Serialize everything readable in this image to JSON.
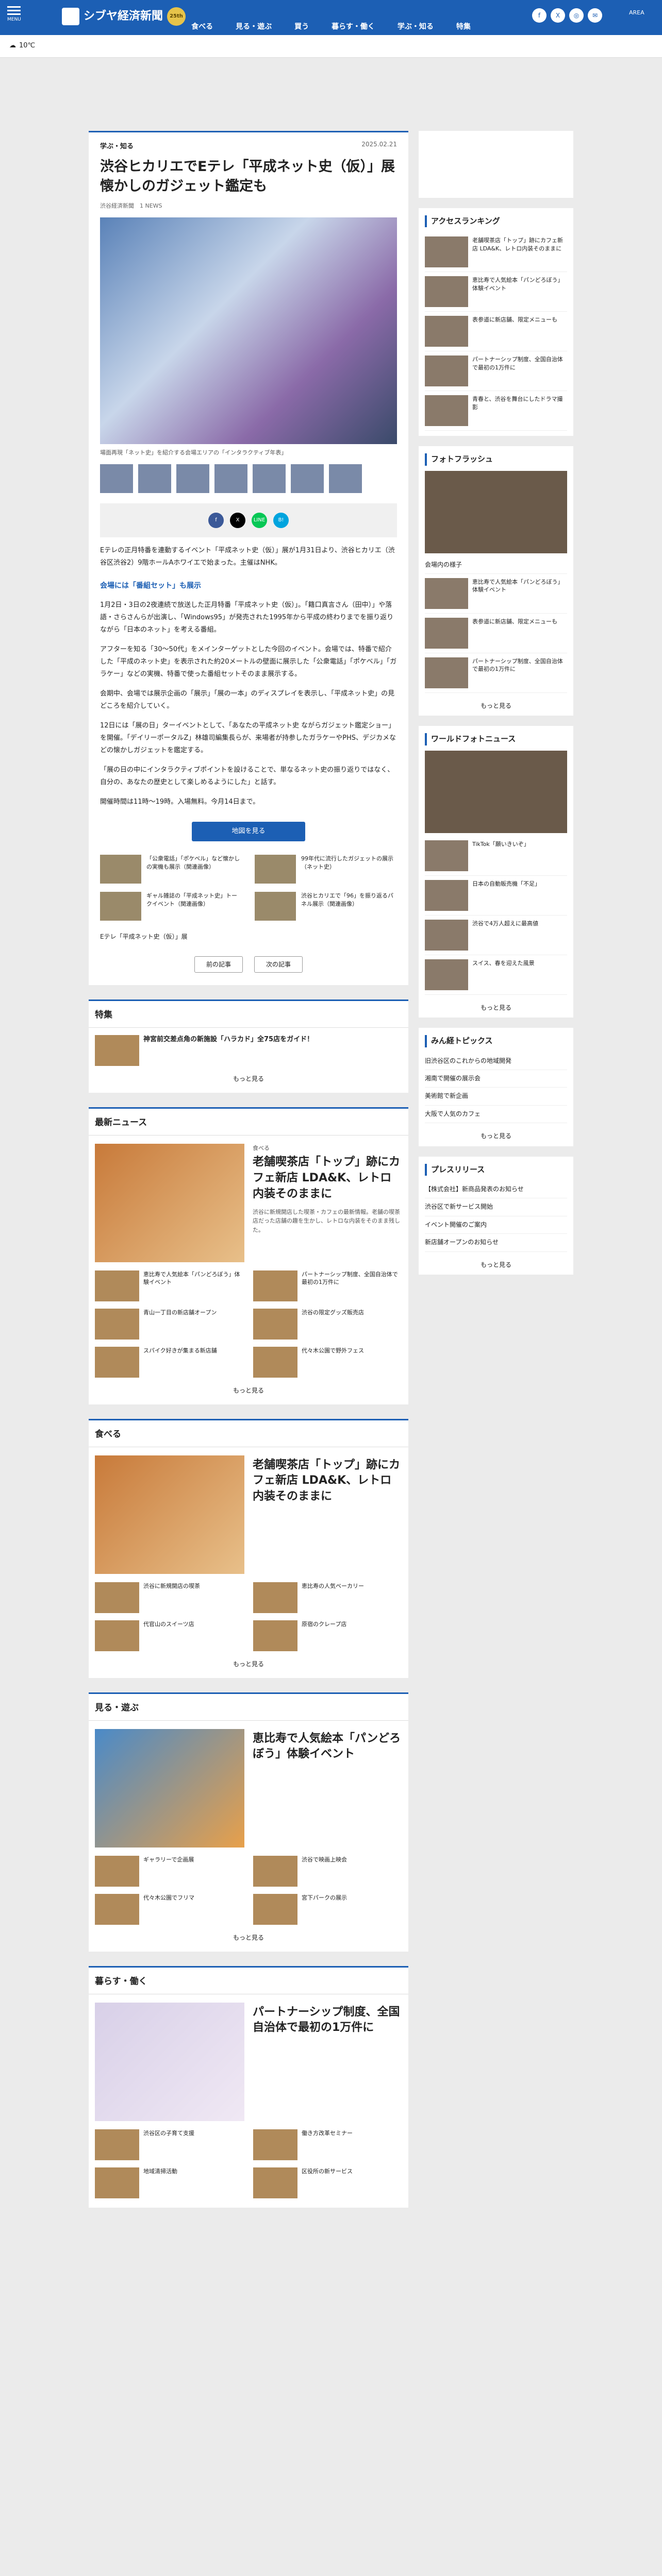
{
  "header": {
    "menu_label": "MENU",
    "site_name": "シブヤ経済新聞",
    "anniversary": "25th",
    "area_label": "AREA",
    "sns": [
      "f",
      "X",
      "◎",
      "✉"
    ]
  },
  "nav": [
    "食べる",
    "見る・遊ぶ",
    "買う",
    "暮らす・働く",
    "学ぶ・知る",
    "特集"
  ],
  "weather": {
    "temp": "10℃"
  },
  "article": {
    "category": "学ぶ・知る",
    "date": "2025.02.21",
    "title": "渋谷ヒカリエでEテレ「平成ネット史（仮）」展　懐かしのガジェット鑑定も",
    "meta": "渋谷経済新聞　1 NEWS",
    "caption": "場面再現「ネット史」を紹介する会場エリアの「インタラクティブ年表」",
    "share": [
      "f",
      "X",
      "LINE",
      "B!"
    ],
    "paragraphs": [
      "Eテレの正月特番を連動するイベント「平成ネット史（仮）」展が1月31日より、渋谷ヒカリエ（渋谷区渋谷2）9階ホールAホワイエで始まった。主催はNHK。",
      "1月2日・3日の2夜連続で放送した正月特番「平成ネット史（仮）」。「籍口真言さん（田中）」や落語・さらさんらが出演し、「Windows95」が発売された1995年から平成の終わりまでを振り返りながら「日本のネット」を考える番組。",
      "アフターを知る「30〜50代」をメインターゲットとした今回のイベント。会場では、特番で紹介した「平成のネット史」を表示された約20メートルの壁面に展示した「公衆電話」「ポケベル」「ガラケー」などの実機、特番で使った番組セットそのまま展示する。",
      "会期中、会場では展示企画の「展示」「展の一本」のディスプレイを表示し、「平成ネット史」の見どころを紹介していく。",
      "12日には「展の日」ターイベントとして、「あなたの平成ネット史 ながらガジェット鑑定ショー」を開催。「デイリーポータルZ」林雄司編集長らが、来場者が持参したガラケーやPHS、デジカメなどの懐かしガジェットを鑑定する。",
      "「展の日の中にインタラクティブポイントを設けることで、単なるネット史の振り返りではなく、自分の、あなたの歴史として楽しめるようにした」と話す。",
      "開催時間は11時〜19時。入場無料。今月14日まで。"
    ],
    "subhead": "会場には「番組セット」も展示",
    "map_button": "地図を見る",
    "related": [
      "「公衆電話」「ポケベル」など懐かしの実機も展示（関連画像）",
      "99年代に流行したガジェットの展示（ネット史）",
      "ギャル雑誌の「平成ネット史」トークイベント（関連画像）",
      "渋谷ヒカリエで「96」を振り返るパネル展示（関連画像）"
    ],
    "tags": [
      "Eテレ「平成ネット史（仮）」展"
    ],
    "pager": [
      "前の記事",
      "次の記事"
    ]
  },
  "feature": {
    "title": "特集",
    "item": "神宮前交差点角の新施設「ハラカド」全75店をガイド！"
  },
  "latest": {
    "title": "最新ニュース",
    "lead_cat": "食べる",
    "lead_title": "老舗喫茶店「トップ」跡にカフェ新店 LDA&K、レトロ内装そのままに",
    "lead_text": "渋谷に新規開店した喫茶・カフェの最新情報。老舗の喫茶店だった店舗の趣を生かし、レトロな内装をそのまま残した。",
    "items": [
      "恵比寿で人気絵本「パンどろぼう」体験イベント",
      "パートナーシップ制度、全国自治体で最初の1万件に",
      "青山一丁目の新店舗オープン",
      "渋谷の限定グッズ販売店",
      "スパイク好きが集まる新店舗",
      "代々木公園で野外フェス"
    ]
  },
  "eat": {
    "title": "食べる",
    "lead_title": "老舗喫茶店「トップ」跡にカフェ新店 LDA&K、レトロ内装そのままに",
    "items": [
      "渋谷に新規開店の喫茶",
      "恵比寿の人気ベーカリー",
      "代官山のスイーツ店",
      "原宿のクレープ店"
    ]
  },
  "play": {
    "title": "見る・遊ぶ",
    "lead_title": "恵比寿で人気絵本「パンどろぼう」体験イベント",
    "items": [
      "ギャラリーで企画展",
      "渋谷で映画上映会",
      "代々木公園でフリマ",
      "宮下パークの展示"
    ]
  },
  "live": {
    "title": "暮らす・働く",
    "lead_title": "パートナーシップ制度、全国自治体で最初の1万件に",
    "items": [
      "渋谷区の子育て支援",
      "働き方改革セミナー",
      "地域清掃活動",
      "区役所の新サービス"
    ]
  },
  "side": {
    "ranking_title": "アクセスランキング",
    "ranking": [
      "老舗喫茶店「トップ」跡にカフェ新店 LDA&K、レトロ内装そのままに",
      "恵比寿で人気絵本「パンどろぼう」体験イベント",
      "表参道に新店舗、限定メニューも",
      "パートナーシップ制度、全国自治体で最初の1万件に",
      "青春と、渋谷を舞台にしたドラマ撮影"
    ],
    "photo_title": "フォトフラッシュ",
    "photo_caption": "会場内の様子",
    "world_title": "ワールドフォトニュース",
    "world": [
      "TikTok「願いきいぞ」",
      "日本の自動販売機「不足」",
      "渋谷で4万人超えに最高値",
      "スイス、春を迎えた風景"
    ],
    "minkei_title": "みん経トピックス",
    "minkei": [
      "旧渋谷区のこれからの地域開発",
      "湘南で開催の展示会",
      "美術館で新企画",
      "大阪で人気のカフェ"
    ],
    "press_title": "プレスリリース",
    "press": [
      "【株式会社】新商品発表のお知らせ",
      "渋谷区で新サービス開始",
      "イベント開催のご案内",
      "新店舗オープンのお知らせ"
    ],
    "more": "もっと見る"
  }
}
